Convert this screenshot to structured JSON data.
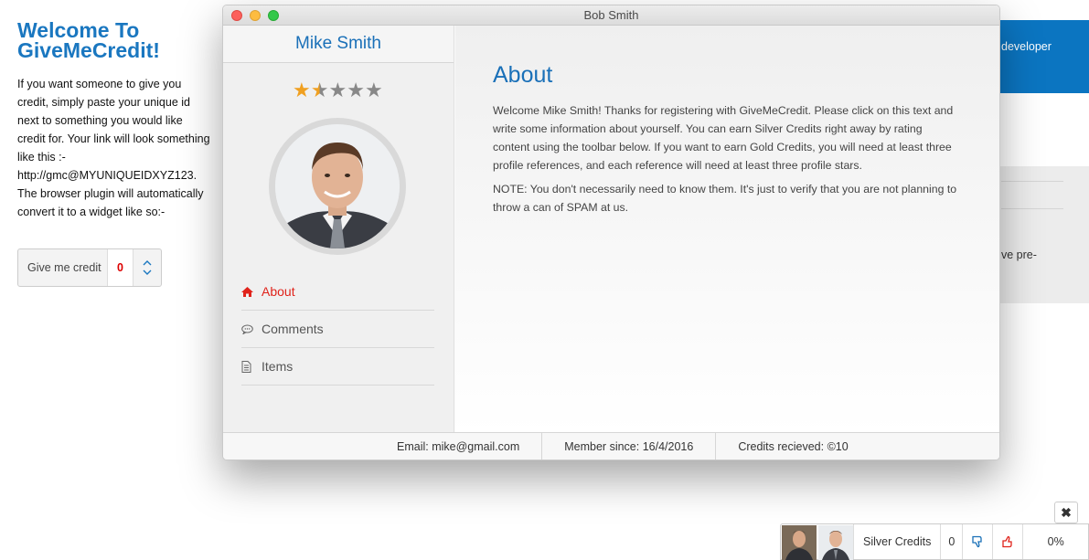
{
  "background": {
    "title": "Welcome To GiveMeCredit!",
    "intro": "If you want someone to give you credit, simply paste your unique id next to something you would like credit for. Your link will look something like this :- http://gmc@MYUNIQUEIDXYZ123. The browser plugin will automatically convert it to a widget like so:-",
    "widget": {
      "label": "Give me credit",
      "count": "0"
    },
    "blue_panel_text": "developer",
    "grey_panel_text": "ve pre-"
  },
  "window": {
    "title": "Bob Smith",
    "profile": {
      "name": "Mike Smith",
      "rating": 1.5,
      "max_rating": 5
    },
    "nav": [
      {
        "label": "About",
        "icon": "home-icon",
        "active": true
      },
      {
        "label": "Comments",
        "icon": "comment-icon",
        "active": false
      },
      {
        "label": "Items",
        "icon": "document-icon",
        "active": false
      }
    ],
    "content": {
      "heading": "About",
      "paragraph1": "Welcome Mike Smith! Thanks for registering with GiveMeCredit. Please click on this text and write some information about yourself. You can earn Silver Credits right away by rating content using the toolbar below. If you want to earn Gold Credits, you will need at least three profile references, and each reference will need at least three profile stars.",
      "paragraph2": "NOTE: You don't necessarily need to know them. It's just to verify that you are not planning to throw a can of SPAM at us."
    },
    "status": {
      "email": "Email: mike@gmail.com",
      "member_since": "Member since: 16/4/2016",
      "credits": "Credits recieved: ©10"
    }
  },
  "credit_widget": {
    "label": "Silver Credits",
    "count": "0",
    "percent": "0%",
    "close_label": "✖"
  },
  "colors": {
    "accent_blue": "#1a70b8",
    "active_red": "#e0231b",
    "star_gold": "#f0a020"
  }
}
